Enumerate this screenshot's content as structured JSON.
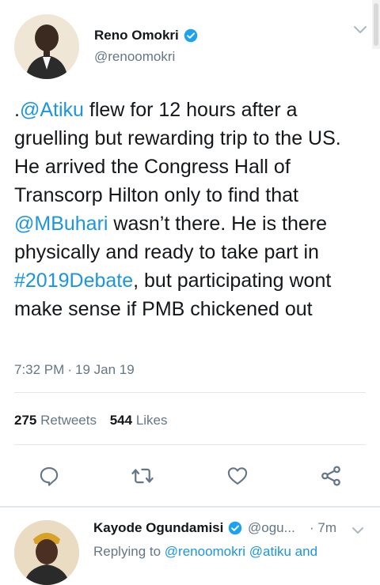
{
  "tweet": {
    "author_name": "Reno Omokri",
    "author_handle": "@renoomokri",
    "text_parts": [
      {
        "text": ".",
        "link": false
      },
      {
        "text": "@Atiku",
        "link": true
      },
      {
        "text": " flew for 12 hours after a gruelling but rewarding trip to the US. He arrived the Congress Hall of Transcorp Hilton only to find that ",
        "link": false
      },
      {
        "text": "@MBuhari",
        "link": true
      },
      {
        "text": " wasn’t there. He is there physically and ready to take part in ",
        "link": false
      },
      {
        "text": "#2019Debate",
        "link": true
      },
      {
        "text": ", but participating wont make sense if PMB chickened out",
        "link": false
      }
    ],
    "time": "7:32 PM",
    "separator": "·",
    "date": "19 Jan 19",
    "retweets_count": "275",
    "retweets_label": "Retweets",
    "likes_count": "544",
    "likes_label": "Likes"
  },
  "actions": [
    {
      "name": "reply-icon"
    },
    {
      "name": "retweet-icon"
    },
    {
      "name": "like-icon"
    },
    {
      "name": "share-icon"
    }
  ],
  "reply": {
    "author_name": "Kayode Ogundamisi",
    "author_handle": "@ogu...",
    "separator": "·",
    "time": "7m",
    "replying_prefix": "Replying to ",
    "replying_targets": "@renoomokri @atiku and"
  },
  "colors": {
    "link": "#1b95e0",
    "secondary_text": "#657786",
    "verified": "#1da1f2"
  }
}
